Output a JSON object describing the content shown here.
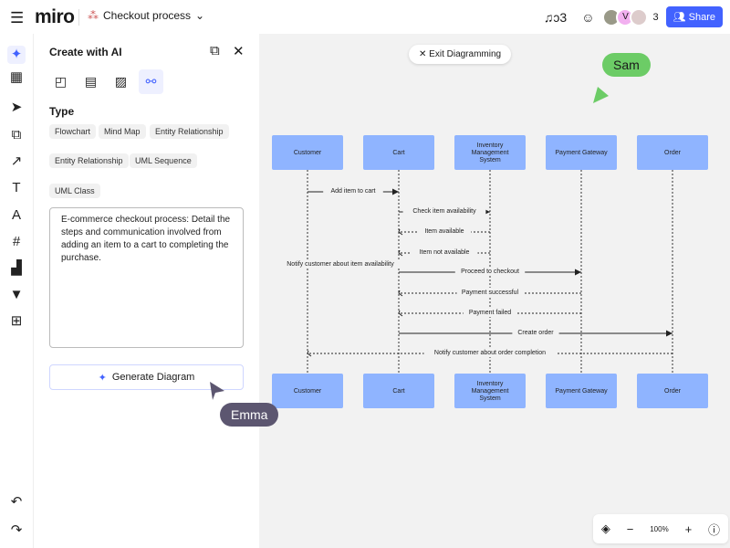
{
  "header": {
    "logo": "miro",
    "board_title": "Checkout process",
    "avatar_initial": "V",
    "collaborator_count": "3",
    "share_label": "Share"
  },
  "left_toolbar": [
    "ai-sparkle",
    "templates",
    "select",
    "shapes",
    "pen-arrow",
    "text",
    "pen",
    "frame",
    "chart",
    "upvote",
    "add",
    "undo",
    "redo"
  ],
  "panel": {
    "title": "Create with AI",
    "type_label": "Type",
    "types": [
      "Flowchart",
      "Mind Map",
      "Entity Relationship",
      "Entity Relationship",
      "UML Sequence",
      "UML Class"
    ],
    "prompt": "E-commerce checkout process: Detail the steps and communication involved from adding an item to a cart to completing the purchase.",
    "generate_label": "Generate Diagram"
  },
  "canvas": {
    "exit_label": "Exit Diagramming",
    "cursors": [
      {
        "name": "Sam",
        "color": "#6ccc66"
      },
      {
        "name": "Emma",
        "color": "#5c5670"
      }
    ]
  },
  "diagram": {
    "participants": [
      "Customer",
      "Cart",
      "Inventory Management System",
      "Payment Gateway",
      "Order"
    ],
    "box_color": "#8fb4ff",
    "messages": [
      {
        "label": "Add item to cart",
        "from": 0,
        "to": 1,
        "dashed": false
      },
      {
        "label": "Check item availability",
        "from": 1,
        "to": 2,
        "dashed": false
      },
      {
        "label": "Item available",
        "from": 2,
        "to": 1,
        "dashed": true
      },
      {
        "label": "Item not available",
        "from": 2,
        "to": 1,
        "dashed": true
      },
      {
        "label": "Notify customer about item availability",
        "from": 1,
        "to": 0,
        "dashed": true,
        "no_line": true
      },
      {
        "label": "Proceed to checkout",
        "from": 1,
        "to": 3,
        "dashed": false
      },
      {
        "label": "Payment successful",
        "from": 3,
        "to": 1,
        "dashed": true
      },
      {
        "label": "Payment failed",
        "from": 3,
        "to": 1,
        "dashed": true
      },
      {
        "label": "Create order",
        "from": 1,
        "to": 4,
        "dashed": false
      },
      {
        "label": "Notify customer about order completion",
        "from": 4,
        "to": 0,
        "dashed": true
      }
    ]
  },
  "zoom": {
    "level": "100%"
  }
}
